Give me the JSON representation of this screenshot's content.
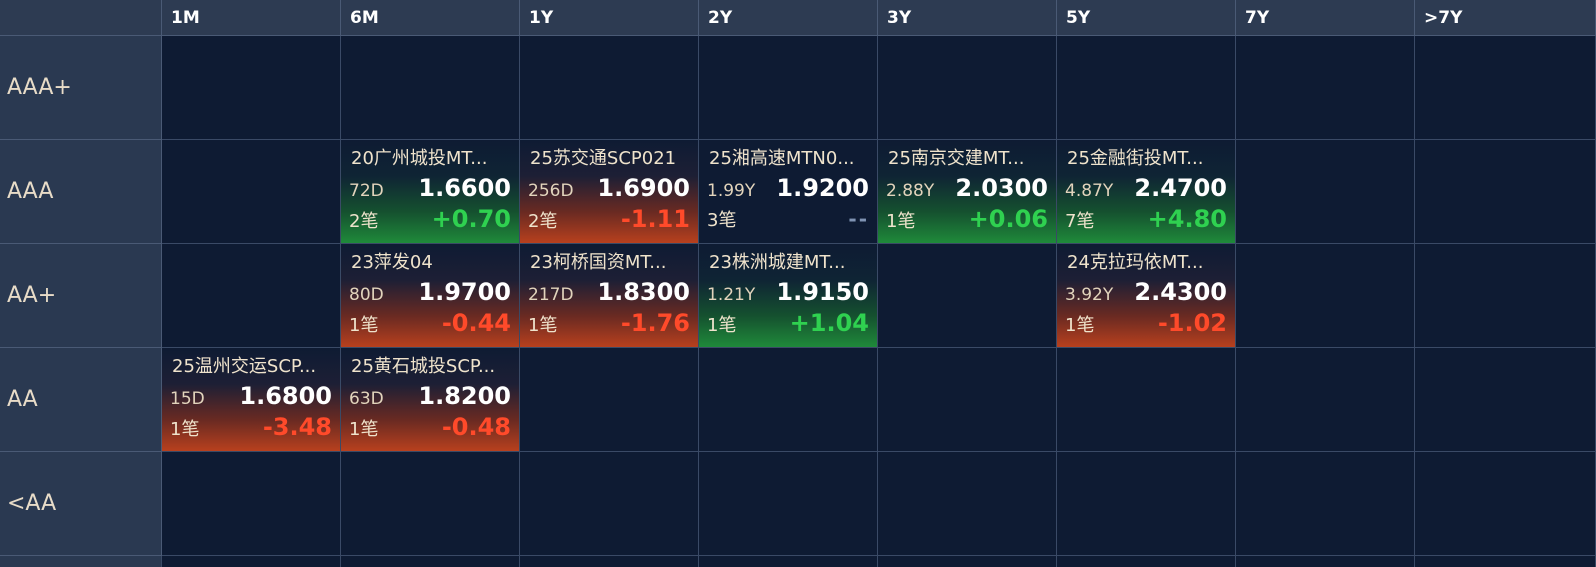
{
  "columns": [
    "1M",
    "6M",
    "1Y",
    "2Y",
    "3Y",
    "5Y",
    "7Y",
    ">7Y"
  ],
  "rows": [
    "AAA+",
    "AAA",
    "AA+",
    "AA",
    "<AA"
  ],
  "colors": {
    "up": "#2fd150",
    "down": "#ff4a2a",
    "flat": "#7f93b3",
    "header_bg": "#2d3b52",
    "cell_bg": "#0e1b33"
  },
  "cells": [
    {
      "row": 1,
      "col": 1,
      "name": "20广州城投MT...",
      "tenor": "72D",
      "yield": "1.6600",
      "trades": "2笔",
      "change": "+0.70",
      "dir": "up"
    },
    {
      "row": 1,
      "col": 2,
      "name": "25苏交通SCP021",
      "tenor": "256D",
      "yield": "1.6900",
      "trades": "2笔",
      "change": "-1.11",
      "dir": "down"
    },
    {
      "row": 1,
      "col": 3,
      "name": "25湘高速MTN0...",
      "tenor": "1.99Y",
      "yield": "1.9200",
      "trades": "3笔",
      "change": "--",
      "dir": "flat"
    },
    {
      "row": 1,
      "col": 4,
      "name": "25南京交建MT...",
      "tenor": "2.88Y",
      "yield": "2.0300",
      "trades": "1笔",
      "change": "+0.06",
      "dir": "up"
    },
    {
      "row": 1,
      "col": 5,
      "name": "25金融街投MT...",
      "tenor": "4.87Y",
      "yield": "2.4700",
      "trades": "7笔",
      "change": "+4.80",
      "dir": "up"
    },
    {
      "row": 2,
      "col": 1,
      "name": "23萍发04",
      "tenor": "80D",
      "yield": "1.9700",
      "trades": "1笔",
      "change": "-0.44",
      "dir": "down"
    },
    {
      "row": 2,
      "col": 2,
      "name": "23柯桥国资MT...",
      "tenor": "217D",
      "yield": "1.8300",
      "trades": "1笔",
      "change": "-1.76",
      "dir": "down"
    },
    {
      "row": 2,
      "col": 3,
      "name": "23株洲城建MT...",
      "tenor": "1.21Y",
      "yield": "1.9150",
      "trades": "1笔",
      "change": "+1.04",
      "dir": "up"
    },
    {
      "row": 2,
      "col": 5,
      "name": "24克拉玛依MT...",
      "tenor": "3.92Y",
      "yield": "2.4300",
      "trades": "1笔",
      "change": "-1.02",
      "dir": "down"
    },
    {
      "row": 3,
      "col": 0,
      "name": "25温州交运SCP...",
      "tenor": "15D",
      "yield": "1.6800",
      "trades": "1笔",
      "change": "-3.48",
      "dir": "down"
    },
    {
      "row": 3,
      "col": 1,
      "name": "25黄石城投SCP...",
      "tenor": "63D",
      "yield": "1.8200",
      "trades": "1笔",
      "change": "-0.48",
      "dir": "down"
    }
  ]
}
